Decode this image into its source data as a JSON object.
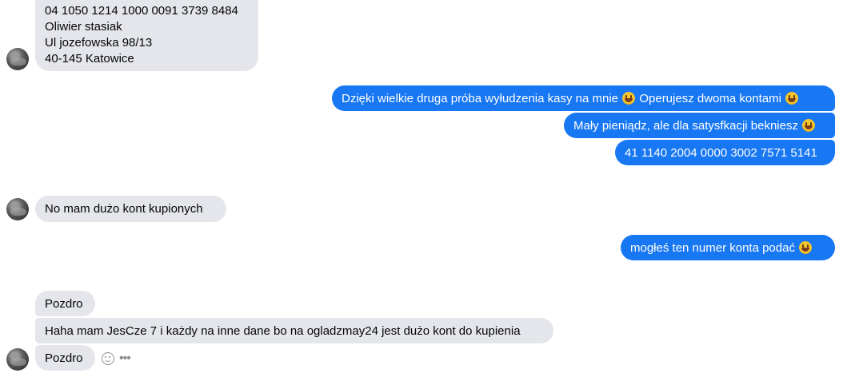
{
  "conversation": {
    "messages": [
      {
        "id": "m1",
        "side": "in",
        "lines": [
          "04 1050 1214 1000 0091 3739 8484",
          "Oliwier stasiak",
          "Ul jozefowska 98/13",
          "40-145 Katowice"
        ]
      },
      {
        "id": "m2",
        "side": "out",
        "parts": [
          "Dzięki wielkie druga próba wyłudzenia kasy na mnie ",
          " Operujesz dwoma kontami "
        ]
      },
      {
        "id": "m3",
        "side": "out",
        "parts": [
          "Mały pieniądz, ale dla satysfkacji bekniesz "
        ]
      },
      {
        "id": "m4",
        "side": "out",
        "text": "41 1140 2004 0000 3002 7571 5141"
      },
      {
        "id": "m5",
        "side": "in",
        "text": "No mam dużo kont kupionych"
      },
      {
        "id": "m6",
        "side": "out",
        "parts": [
          "mogłeś ten numer konta podać "
        ]
      },
      {
        "id": "m7",
        "side": "in",
        "text": "Pozdro"
      },
      {
        "id": "m8",
        "side": "in",
        "text": "Haha mam JesCze 7 i każdy na inne dane bo na ogladzmay24 jest dużo kont do kupienia"
      },
      {
        "id": "m9",
        "side": "in",
        "text": "Pozdro"
      }
    ],
    "icons": {
      "emoji": "grinning-squinting-face",
      "react": "smiley-react-icon",
      "more": "more-options-icon"
    },
    "colors": {
      "incoming_bubble": "#e4e6eb",
      "outgoing_bubble": "#1877f2",
      "outgoing_text": "#ffffff",
      "action_icons": "#8a8d91"
    }
  }
}
